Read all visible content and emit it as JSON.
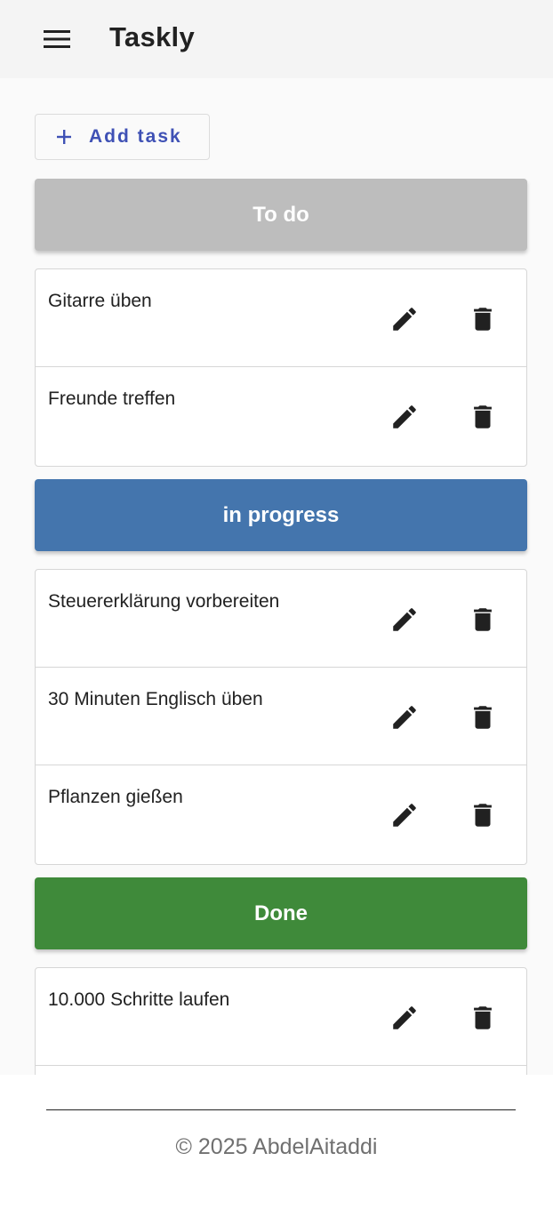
{
  "appbar": {
    "title": "Taskly",
    "menu_icon": "hamburger-menu-icon"
  },
  "toolbar": {
    "add_task_label": "Add task",
    "add_icon": "plus-icon",
    "accent_color": "#3f51b5"
  },
  "columns": [
    {
      "title": "To do",
      "color": "#bdbdbd",
      "tasks": [
        {
          "text": "Gitarre üben"
        },
        {
          "text": "Freunde treffen"
        }
      ]
    },
    {
      "title": "in progress",
      "color": "#4475ad",
      "tasks": [
        {
          "text": "Steuererklärung vorbereiten"
        },
        {
          "text": "30 Minuten Englisch üben"
        },
        {
          "text": "Pflanzen gießen"
        }
      ]
    },
    {
      "title": "Done",
      "color": "#3f8a3a",
      "tasks": [
        {
          "text": "10.000 Schritte laufen"
        },
        {
          "text": ""
        }
      ]
    }
  ],
  "task_actions": {
    "edit_icon": "pencil-icon",
    "delete_icon": "trash-icon"
  },
  "footer": {
    "text": "© 2025 AbdelAitaddi"
  }
}
